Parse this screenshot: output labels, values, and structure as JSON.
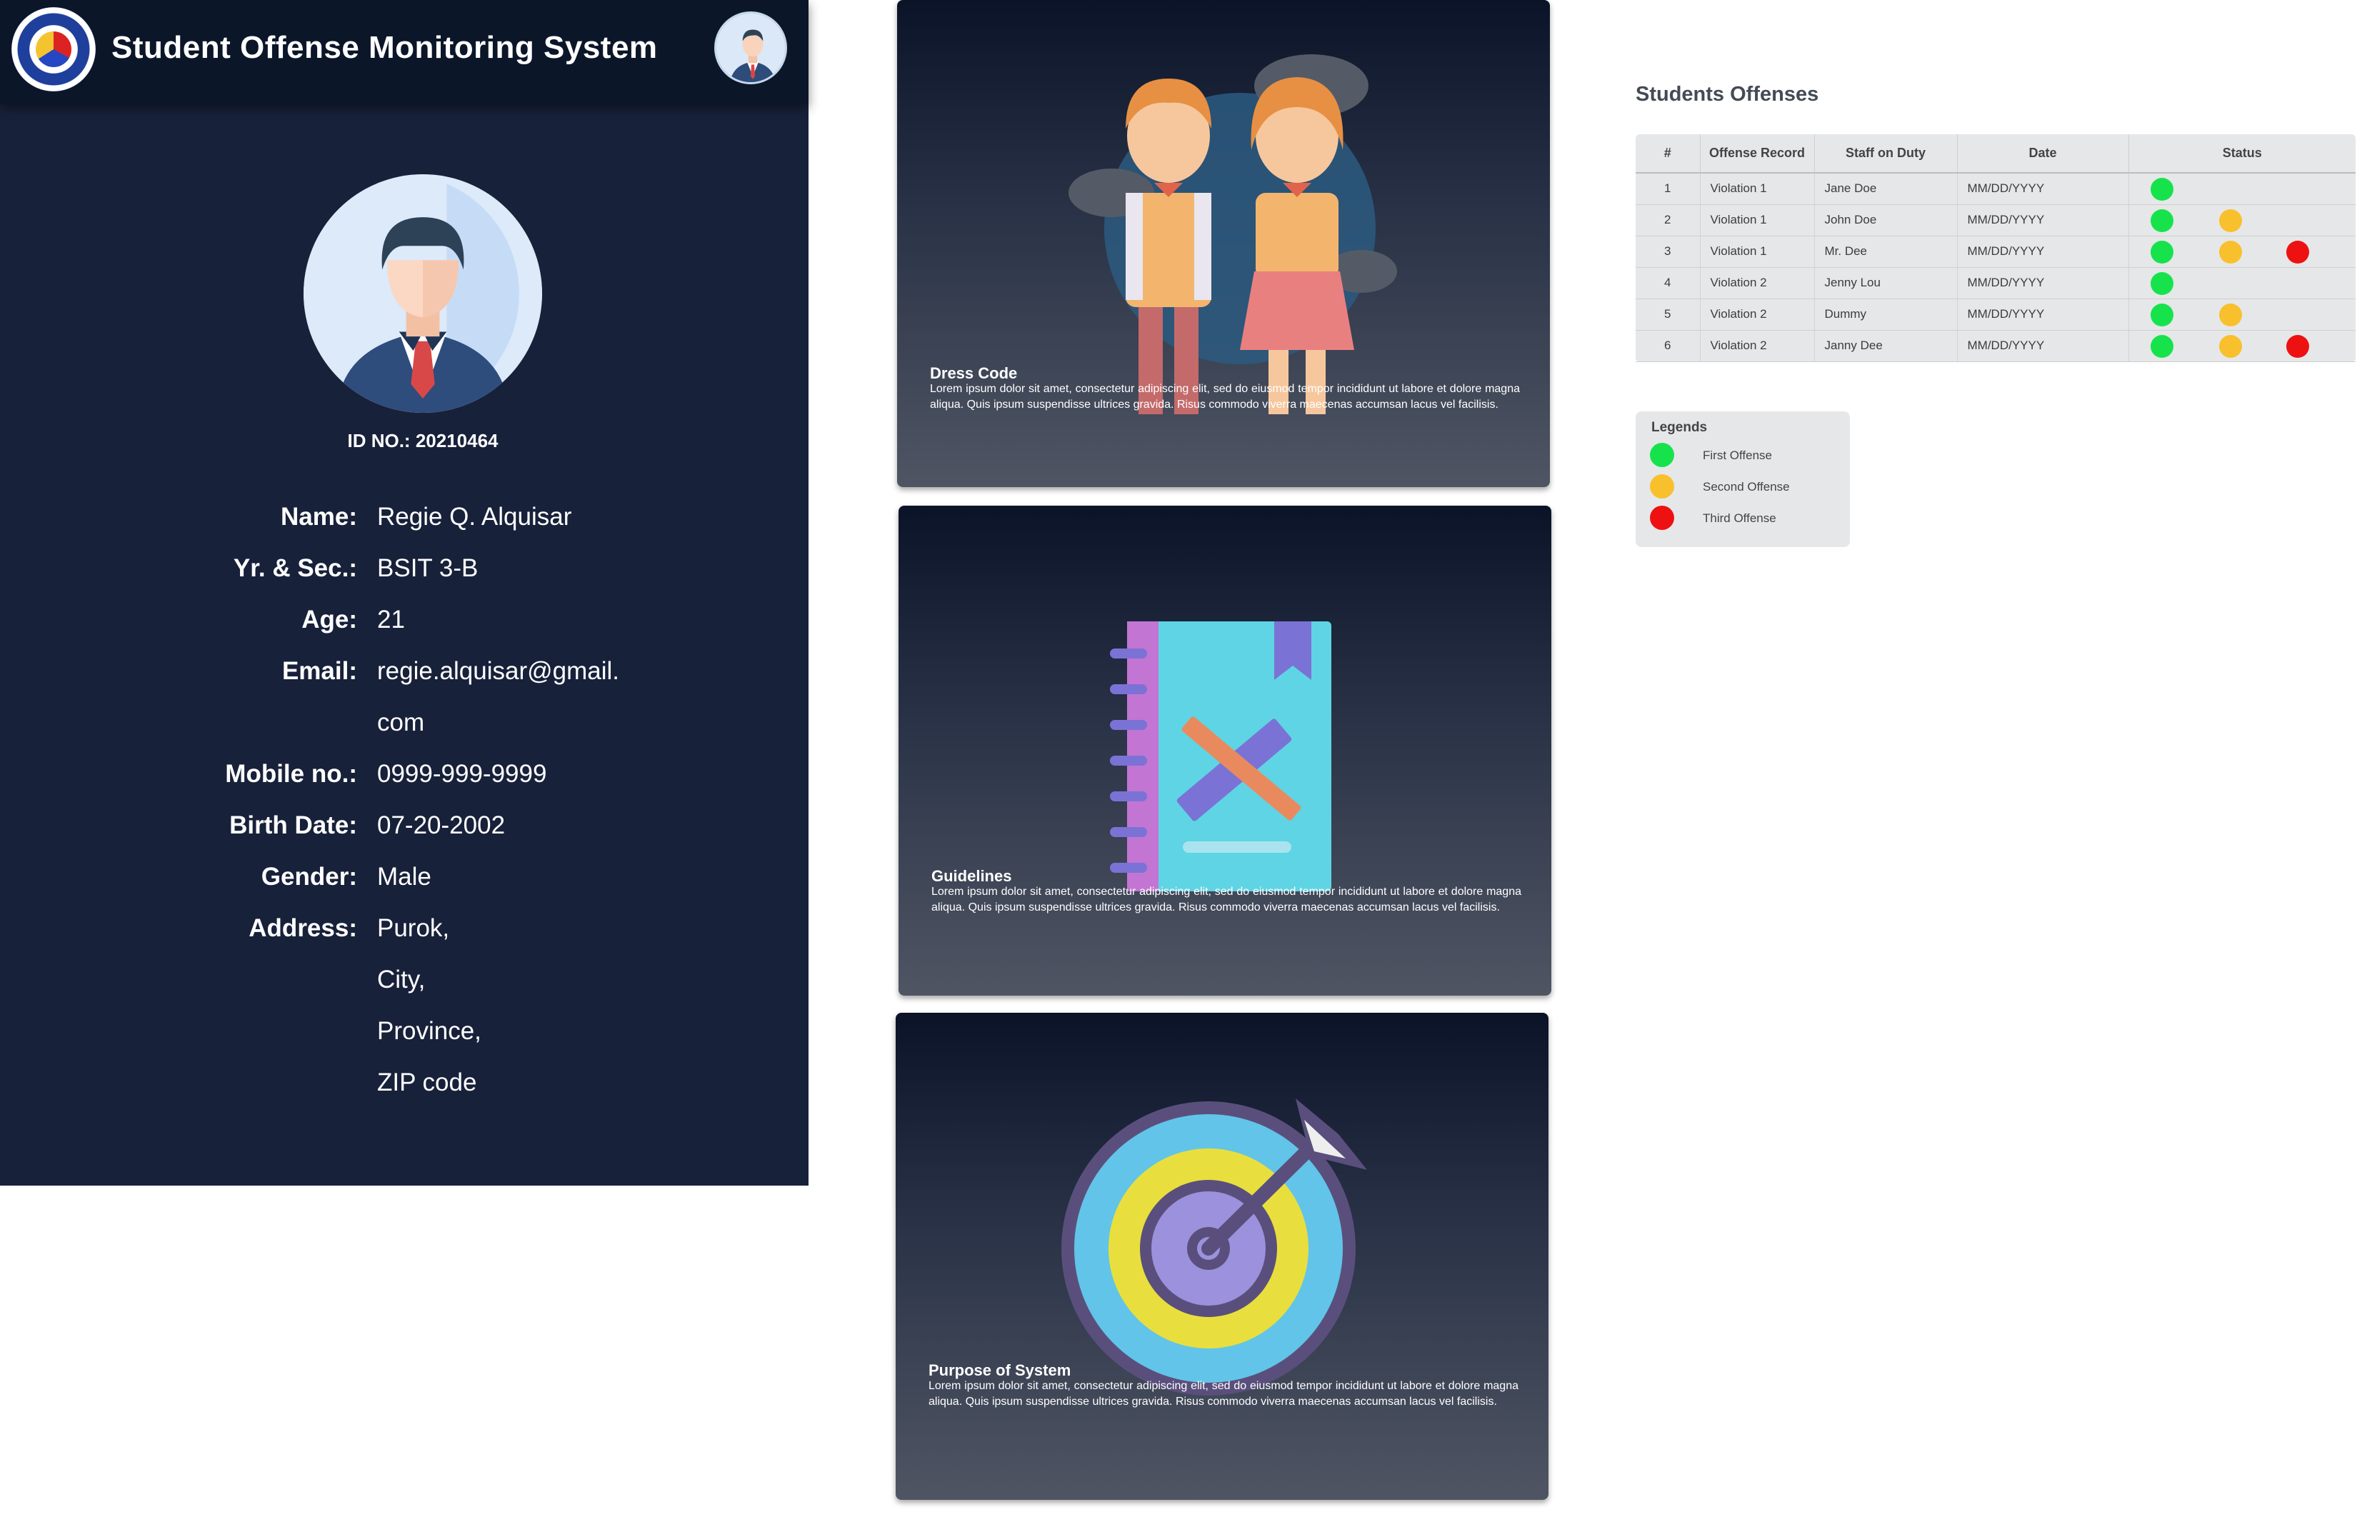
{
  "header": {
    "title": "Student Offense Monitoring System"
  },
  "profile": {
    "id_line": "ID NO.: 20210464",
    "fields": [
      {
        "label": "Name:",
        "value": "Regie Q. Alquisar"
      },
      {
        "label": "Yr. & Sec.:",
        "value": "BSIT 3-B"
      },
      {
        "label": "Age:",
        "value": "21"
      },
      {
        "label": "Email:",
        "value": "regie.alquisar@gmail."
      },
      {
        "label": "",
        "value": "com"
      },
      {
        "label": "Mobile no.:",
        "value": "0999-999-9999"
      },
      {
        "label": "Birth Date:",
        "value": "07-20-2002"
      },
      {
        "label": "Gender:",
        "value": "Male"
      },
      {
        "label": "Address:",
        "value": "Purok,"
      },
      {
        "label": "",
        "value": "City,"
      },
      {
        "label": "",
        "value": "Province,"
      },
      {
        "label": "",
        "value": "ZIP code"
      }
    ]
  },
  "cards": [
    {
      "title": "Dress Code",
      "text": "Lorem ipsum dolor sit amet, consectetur adipiscing elit, sed do eiusmod tempor incididunt ut labore et dolore magna aliqua. Quis ipsum suspendisse ultrices gravida. Risus commodo viverra maecenas accumsan lacus vel facilisis.",
      "icon": "students-icon"
    },
    {
      "title": "Guidelines",
      "text": "Lorem ipsum dolor sit amet, consectetur adipiscing elit, sed do eiusmod tempor incididunt ut labore et dolore magna aliqua. Quis ipsum suspendisse ultrices gravida. Risus commodo viverra maecenas accumsan lacus vel facilisis.",
      "icon": "notebook-icon"
    },
    {
      "title": "Purpose of System",
      "text": "Lorem ipsum dolor sit amet, consectetur adipiscing elit, sed do eiusmod tempor incididunt ut labore et dolore magna aliqua. Quis ipsum suspendisse ultrices gravida. Risus commodo viverra maecenas accumsan lacus vel facilisis.",
      "icon": "target-icon"
    }
  ],
  "offenses": {
    "title": "Students Offenses",
    "columns": [
      "#",
      "Offense Record",
      "Staff on Duty",
      "Date",
      "Status"
    ],
    "rows": [
      {
        "num": "1",
        "record": "Violation 1",
        "staff": "Jane Doe",
        "date": "MM/DD/YYYY",
        "status": [
          "first"
        ]
      },
      {
        "num": "2",
        "record": "Violation 1",
        "staff": "John Doe",
        "date": "MM/DD/YYYY",
        "status": [
          "first",
          "second"
        ]
      },
      {
        "num": "3",
        "record": "Violation 1",
        "staff": "Mr. Dee",
        "date": "MM/DD/YYYY",
        "status": [
          "first",
          "second",
          "third"
        ]
      },
      {
        "num": "4",
        "record": "Violation 2",
        "staff": "Jenny Lou",
        "date": "MM/DD/YYYY",
        "status": [
          "first"
        ]
      },
      {
        "num": "5",
        "record": "Violation 2",
        "staff": "Dummy",
        "date": "MM/DD/YYYY",
        "status": [
          "first",
          "second"
        ]
      },
      {
        "num": "6",
        "record": "Violation 2",
        "staff": "Janny Dee",
        "date": "MM/DD/YYYY",
        "status": [
          "first",
          "second",
          "third"
        ]
      }
    ]
  },
  "legends": {
    "title": "Legends",
    "items": [
      {
        "key": "first",
        "label": "First Offense",
        "color": "#16e34c"
      },
      {
        "key": "second",
        "label": "Second Offense",
        "color": "#f8c02c"
      },
      {
        "key": "third",
        "label": "Third Offense",
        "color": "#ee1111"
      }
    ]
  }
}
